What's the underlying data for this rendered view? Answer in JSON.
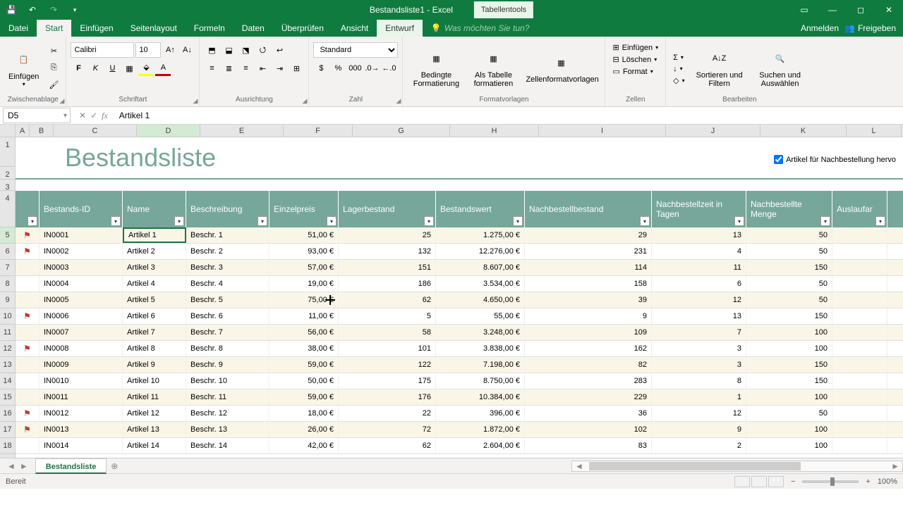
{
  "app": {
    "title": "Bestandsliste1 - Excel",
    "contextual_tab_group": "Tabellentools"
  },
  "tabs": {
    "file": "Datei",
    "home": "Start",
    "insert": "Einfügen",
    "layout": "Seitenlayout",
    "formulas": "Formeln",
    "data": "Daten",
    "review": "Überprüfen",
    "view": "Ansicht",
    "design": "Entwurf",
    "tell_me": "Was möchten Sie tun?",
    "signin": "Anmelden",
    "share": "Freigeben"
  },
  "ribbon": {
    "clipboard": {
      "label": "Zwischenablage",
      "paste": "Einfügen"
    },
    "font": {
      "label": "Schriftart",
      "name": "Calibri",
      "size": "10",
      "bold": "F",
      "italic": "K",
      "underline": "U"
    },
    "alignment": {
      "label": "Ausrichtung"
    },
    "number": {
      "label": "Zahl",
      "format": "Standard"
    },
    "styles": {
      "label": "Formatvorlagen",
      "conditional": "Bedingte Formatierung",
      "as_table": "Als Tabelle formatieren",
      "cell_styles": "Zellenformatvorlagen"
    },
    "cells": {
      "label": "Zellen",
      "insert": "Einfügen",
      "delete": "Löschen",
      "format": "Format"
    },
    "editing": {
      "label": "Bearbeiten",
      "sort": "Sortieren und Filtern",
      "find": "Suchen und Auswählen"
    }
  },
  "formula_bar": {
    "name_box": "D5",
    "value": "Artikel 1"
  },
  "columns": [
    "A",
    "B",
    "C",
    "D",
    "E",
    "F",
    "G",
    "H",
    "I",
    "J",
    "K",
    "L"
  ],
  "sheet": {
    "title": "Bestandsliste",
    "reorder_label": "Artikel für Nachbestellung hervo",
    "headers": [
      "Bestands-ID",
      "Name",
      "Beschreibung",
      "Einzelpreis",
      "Lagerbestand",
      "Bestandswert",
      "Nachbestellbestand",
      "Nachbestellzeit in Tagen",
      "Nachbestellte Menge",
      "Auslaufar"
    ],
    "rows": [
      {
        "flag": true,
        "id": "IN0001",
        "name": "Artikel 1",
        "desc": "Beschr. 1",
        "price": "51,00 €",
        "stock": "25",
        "value": "1.275,00 €",
        "reorder": "29",
        "days": "13",
        "qty": "50"
      },
      {
        "flag": true,
        "id": "IN0002",
        "name": "Artikel 2",
        "desc": "Beschr. 2",
        "price": "93,00 €",
        "stock": "132",
        "value": "12.276,00 €",
        "reorder": "231",
        "days": "4",
        "qty": "50"
      },
      {
        "flag": false,
        "id": "IN0003",
        "name": "Artikel 3",
        "desc": "Beschr. 3",
        "price": "57,00 €",
        "stock": "151",
        "value": "8.607,00 €",
        "reorder": "114",
        "days": "11",
        "qty": "150"
      },
      {
        "flag": false,
        "id": "IN0004",
        "name": "Artikel 4",
        "desc": "Beschr. 4",
        "price": "19,00 €",
        "stock": "186",
        "value": "3.534,00 €",
        "reorder": "158",
        "days": "6",
        "qty": "50"
      },
      {
        "flag": false,
        "id": "IN0005",
        "name": "Artikel 5",
        "desc": "Beschr. 5",
        "price": "75,00 €",
        "stock": "62",
        "value": "4.650,00 €",
        "reorder": "39",
        "days": "12",
        "qty": "50"
      },
      {
        "flag": true,
        "id": "IN0006",
        "name": "Artikel 6",
        "desc": "Beschr. 6",
        "price": "11,00 €",
        "stock": "5",
        "value": "55,00 €",
        "reorder": "9",
        "days": "13",
        "qty": "150"
      },
      {
        "flag": false,
        "id": "IN0007",
        "name": "Artikel 7",
        "desc": "Beschr. 7",
        "price": "56,00 €",
        "stock": "58",
        "value": "3.248,00 €",
        "reorder": "109",
        "days": "7",
        "qty": "100"
      },
      {
        "flag": true,
        "id": "IN0008",
        "name": "Artikel 8",
        "desc": "Beschr. 8",
        "price": "38,00 €",
        "stock": "101",
        "value": "3.838,00 €",
        "reorder": "162",
        "days": "3",
        "qty": "100"
      },
      {
        "flag": false,
        "id": "IN0009",
        "name": "Artikel 9",
        "desc": "Beschr. 9",
        "price": "59,00 €",
        "stock": "122",
        "value": "7.198,00 €",
        "reorder": "82",
        "days": "3",
        "qty": "150"
      },
      {
        "flag": false,
        "id": "IN0010",
        "name": "Artikel 10",
        "desc": "Beschr. 10",
        "price": "50,00 €",
        "stock": "175",
        "value": "8.750,00 €",
        "reorder": "283",
        "days": "8",
        "qty": "150"
      },
      {
        "flag": false,
        "id": "IN0011",
        "name": "Artikel 11",
        "desc": "Beschr. 11",
        "price": "59,00 €",
        "stock": "176",
        "value": "10.384,00 €",
        "reorder": "229",
        "days": "1",
        "qty": "100"
      },
      {
        "flag": true,
        "id": "IN0012",
        "name": "Artikel 12",
        "desc": "Beschr. 12",
        "price": "18,00 €",
        "stock": "22",
        "value": "396,00 €",
        "reorder": "36",
        "days": "12",
        "qty": "50"
      },
      {
        "flag": true,
        "id": "IN0013",
        "name": "Artikel 13",
        "desc": "Beschr. 13",
        "price": "26,00 €",
        "stock": "72",
        "value": "1.872,00 €",
        "reorder": "102",
        "days": "9",
        "qty": "100"
      },
      {
        "flag": false,
        "id": "IN0014",
        "name": "Artikel 14",
        "desc": "Beschr. 14",
        "price": "42,00 €",
        "stock": "62",
        "value": "2.604,00 €",
        "reorder": "83",
        "days": "2",
        "qty": "100"
      }
    ]
  },
  "sheet_tab": "Bestandsliste",
  "status": {
    "ready": "Bereit",
    "zoom": "100%"
  }
}
